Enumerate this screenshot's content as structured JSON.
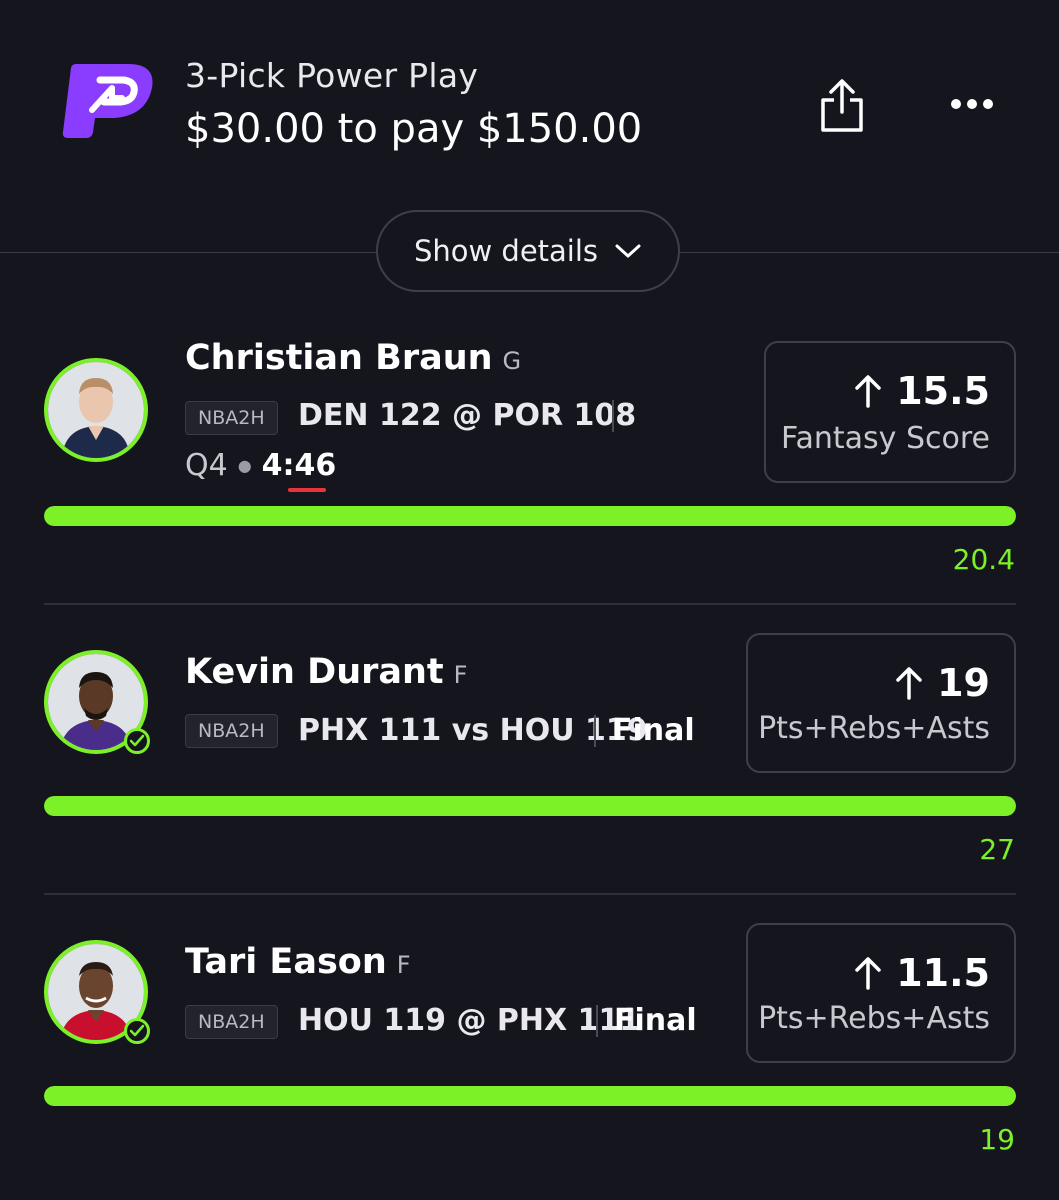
{
  "header": {
    "title": "3-Pick Power Play",
    "payout": "$30.00 to pay $150.00",
    "share_icon": "share-icon",
    "more_icon": "more-icon",
    "brand_color": "#8b3dff"
  },
  "details_toggle": {
    "label": "Show details",
    "icon": "chevron-down-icon"
  },
  "picks": [
    {
      "player": "Christian Braun",
      "position": "G",
      "league": "NBA2H",
      "game": "DEN 122 @ POR 108",
      "period": "Q4",
      "clock": "4:46",
      "line": "15.5",
      "direction": "up",
      "stat": "Fantasy Score",
      "result": "20.4",
      "progress": 1.0,
      "complete": false
    },
    {
      "player": "Kevin Durant",
      "position": "F",
      "league": "NBA2H",
      "game": "PHX 111 vs HOU 119",
      "status": "Final",
      "line": "19",
      "direction": "up",
      "stat": "Pts+Rebs+Asts",
      "result": "27",
      "progress": 1.0,
      "complete": true
    },
    {
      "player": "Tari Eason",
      "position": "F",
      "league": "NBA2H",
      "game": "HOU 119 @ PHX 111",
      "status": "Final",
      "line": "11.5",
      "direction": "up",
      "stat": "Pts+Rebs+Asts",
      "result": "19",
      "progress": 1.0,
      "complete": true
    }
  ],
  "colors": {
    "accent_green": "#7cf128",
    "live_red": "#e8323c",
    "background": "#15161d"
  }
}
